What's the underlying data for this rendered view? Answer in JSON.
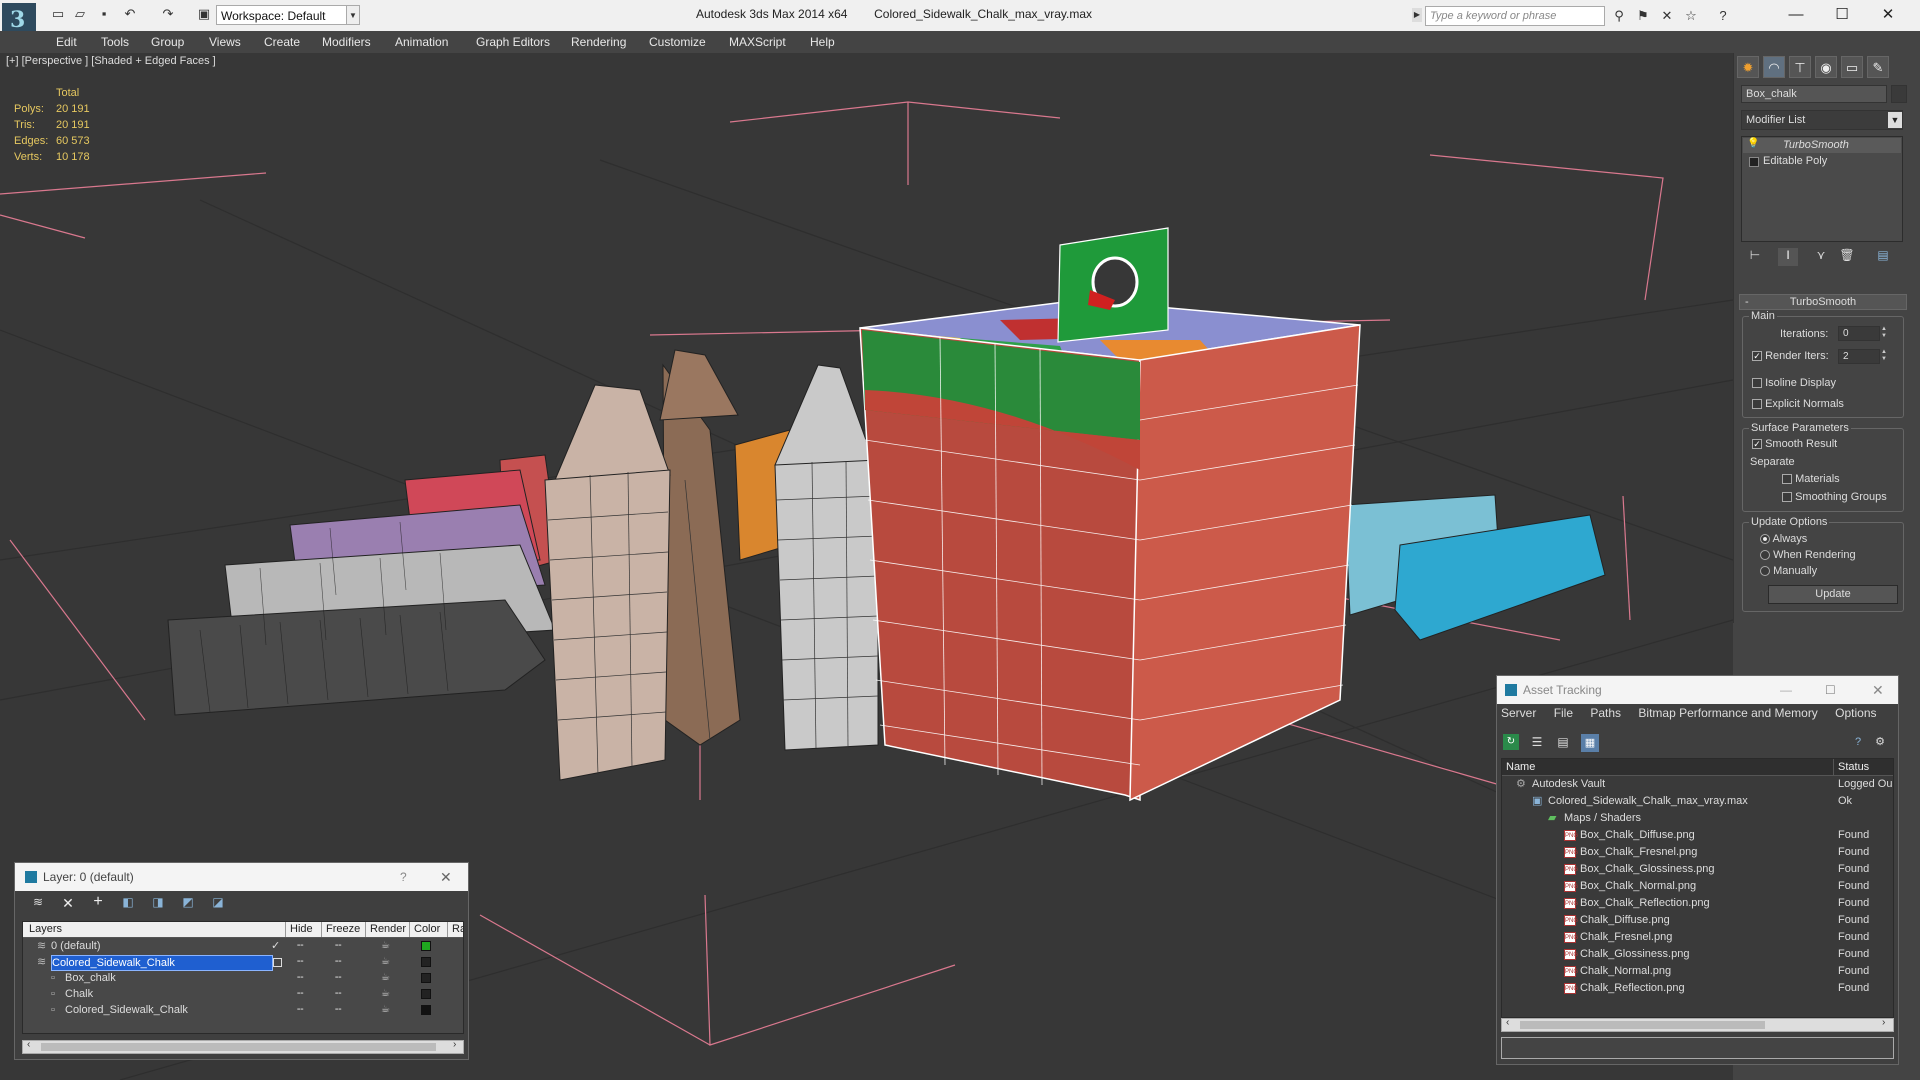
{
  "titlebar": {
    "workspace": "Workspace: Default",
    "app": "Autodesk 3ds Max  2014 x64",
    "file": "Colored_Sidewalk_Chalk_max_vray.max",
    "search_placeholder": "Type a keyword or phrase"
  },
  "menu": [
    "Edit",
    "Tools",
    "Group",
    "Views",
    "Create",
    "Modifiers",
    "Animation",
    "Graph Editors",
    "Rendering",
    "Customize",
    "MAXScript",
    "Help"
  ],
  "viewport": {
    "label": "[+] [Perspective ] [Shaded + Edged Faces ]",
    "stats": {
      "total_label": "Total",
      "polys_label": "Polys:",
      "polys": "20 191",
      "tris_label": "Tris:",
      "tris": "20 191",
      "edges_label": "Edges:",
      "edges": "60 573",
      "verts_label": "Verts:",
      "verts": "10 178"
    }
  },
  "command_panel": {
    "object_name": "Box_chalk",
    "modifier_list": "Modifier List",
    "stack": [
      "TurboSmooth",
      "Editable Poly"
    ],
    "rollout_title": "TurboSmooth",
    "main_label": "Main",
    "iterations_label": "Iterations:",
    "iterations": "0",
    "render_iters_label": "Render Iters:",
    "render_iters": "2",
    "isoline": "Isoline Display",
    "explicit": "Explicit Normals",
    "surface_label": "Surface Parameters",
    "smooth_result": "Smooth Result",
    "separate_label": "Separate",
    "materials": "Materials",
    "smoothing_groups": "Smoothing Groups",
    "update_options": "Update Options",
    "always": "Always",
    "when_rendering": "When Rendering",
    "manually": "Manually",
    "update_button": "Update"
  },
  "asset_tracking": {
    "title": "Asset Tracking",
    "menu": [
      "Server",
      "File",
      "Paths",
      "Bitmap Performance and Memory",
      "Options"
    ],
    "col_name": "Name",
    "col_status": "Status",
    "rows": [
      {
        "name": "Autodesk Vault",
        "status": "Logged Ou"
      },
      {
        "name": "Colored_Sidewalk_Chalk_max_vray.max",
        "status": "Ok"
      },
      {
        "name": "Maps / Shaders",
        "status": ""
      },
      {
        "name": "Box_Chalk_Diffuse.png",
        "status": "Found"
      },
      {
        "name": "Box_Chalk_Fresnel.png",
        "status": "Found"
      },
      {
        "name": "Box_Chalk_Glossiness.png",
        "status": "Found"
      },
      {
        "name": "Box_Chalk_Normal.png",
        "status": "Found"
      },
      {
        "name": "Box_Chalk_Reflection.png",
        "status": "Found"
      },
      {
        "name": "Chalk_Diffuse.png",
        "status": "Found"
      },
      {
        "name": "Chalk_Fresnel.png",
        "status": "Found"
      },
      {
        "name": "Chalk_Glossiness.png",
        "status": "Found"
      },
      {
        "name": "Chalk_Normal.png",
        "status": "Found"
      },
      {
        "name": "Chalk_Reflection.png",
        "status": "Found"
      }
    ]
  },
  "layer_window": {
    "title": "Layer: 0 (default)",
    "help": "?",
    "headers": [
      "Layers",
      "Hide",
      "Freeze",
      "Render",
      "Color",
      "Ra"
    ],
    "rows": [
      {
        "name": "0 (default)",
        "color": "#1fa81f"
      },
      {
        "name": "Colored_Sidewalk_Chalk",
        "color": "#222222"
      },
      {
        "name": "Box_chalk",
        "color": "#222222"
      },
      {
        "name": "Chalk",
        "color": "#222222"
      },
      {
        "name": "Colored_Sidewalk_Chalk",
        "color": "#111111"
      }
    ]
  }
}
